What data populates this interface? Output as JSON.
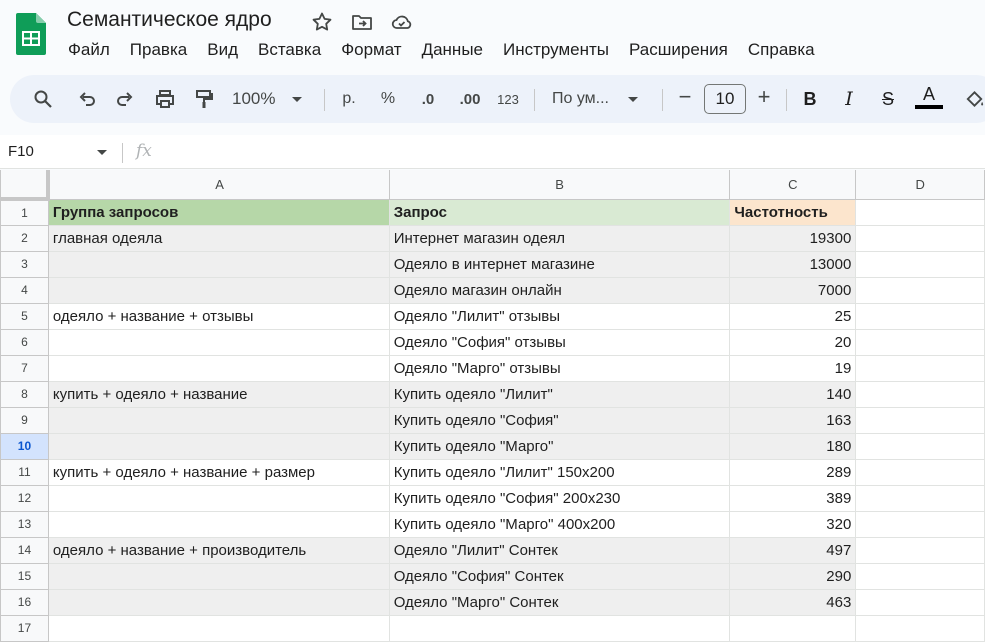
{
  "app": {
    "title": "Семантическое ядро",
    "menu": [
      "Файл",
      "Правка",
      "Вид",
      "Вставка",
      "Формат",
      "Данные",
      "Инструменты",
      "Расширения",
      "Справка"
    ]
  },
  "toolbar": {
    "zoom": "100%",
    "currency": "р.",
    "percent": "%",
    "decrease_decimal": ".0",
    "increase_decimal": ".00",
    "number_format": "123",
    "font": "По ум...",
    "font_size": "10",
    "minus": "−",
    "plus": "+",
    "bold": "B",
    "italic": "I",
    "strike": "S",
    "text_color": "A"
  },
  "formula_bar": {
    "name_box": "F10",
    "fx": "fx",
    "value": ""
  },
  "sheet": {
    "selected_row": 10,
    "columns": [
      "A",
      "B",
      "C",
      "D"
    ],
    "rows": [
      {
        "n": "1",
        "a": "Группа запросов",
        "b": "Запрос",
        "c": "Частотность"
      },
      {
        "n": "2",
        "a": "главная одеяла",
        "b": "Интернет магазин одеял",
        "c": "19300"
      },
      {
        "n": "3",
        "a": "",
        "b": "Одеяло в интернет магазине",
        "c": "13000"
      },
      {
        "n": "4",
        "a": "",
        "b": "Одеяло магазин онлайн",
        "c": "7000"
      },
      {
        "n": "5",
        "a": "одеяло + название + отзывы",
        "b": "Одеяло \"Лилит\" отзывы",
        "c": "25"
      },
      {
        "n": "6",
        "a": "",
        "b": "Одеяло \"София\" отзывы",
        "c": "20"
      },
      {
        "n": "7",
        "a": "",
        "b": "Одеяло \"Марго\" отзывы",
        "c": "19"
      },
      {
        "n": "8",
        "a": "купить + одеяло + название",
        "b": "Купить одеяло \"Лилит\"",
        "c": "140"
      },
      {
        "n": "9",
        "a": "",
        "b": "Купить одеяло \"София\"",
        "c": "163"
      },
      {
        "n": "10",
        "a": "",
        "b": "Купить одеяло \"Марго\"",
        "c": "180"
      },
      {
        "n": "11",
        "a": "купить + одеяло + название + размер",
        "b": "Купить одеяло \"Лилит\" 150x200",
        "c": "289"
      },
      {
        "n": "12",
        "a": "",
        "b": "Купить одеяло \"София\" 200x230",
        "c": "389"
      },
      {
        "n": "13",
        "a": "",
        "b": "Купить одеяло \"Марго\" 400x200",
        "c": "320"
      },
      {
        "n": "14",
        "a": "одеяло + название + производитель",
        "b": "Одеяло \"Лилит\" Сонтек",
        "c": "497"
      },
      {
        "n": "15",
        "a": "",
        "b": "Одеяло \"София\" Сонтек",
        "c": "290"
      },
      {
        "n": "16",
        "a": "",
        "b": "Одеяло \"Марго\" Сонтек",
        "c": "463"
      },
      {
        "n": "17",
        "a": "",
        "b": "",
        "c": ""
      }
    ]
  }
}
